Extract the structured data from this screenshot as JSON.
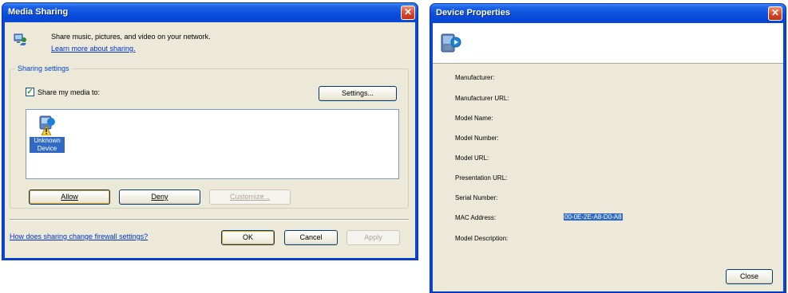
{
  "media_sharing": {
    "title": "Media Sharing",
    "intro_text": "Share music, pictures, and video on your network.",
    "learn_more_link": "Learn more about sharing.",
    "group_title": "Sharing settings",
    "share_checkbox_label": "Share my media to:",
    "share_checked": true,
    "settings_button": "Settings...",
    "device": {
      "name_line1": "Unknown",
      "name_line2": "Device"
    },
    "allow_button": "Allow",
    "deny_button": "Deny",
    "customize_button": "Customize...",
    "firewall_link": "How does sharing change firewall settings?",
    "ok_button": "OK",
    "cancel_button": "Cancel",
    "apply_button": "Apply"
  },
  "device_properties": {
    "title": "Device Properties",
    "labels": {
      "manufacturer": "Manufacturer:",
      "manufacturer_url": "Manufacturer URL:",
      "model_name": "Model Name:",
      "model_number": "Model Number:",
      "model_url": "Model URL:",
      "presentation_url": "Presentation URL:",
      "serial_number": "Serial Number:",
      "mac_address": "MAC Address:",
      "model_description": "Model Description:"
    },
    "mac_value": "00-0E-2E-A8-D0-A8",
    "close_button": "Close"
  },
  "colors": {
    "title_bar": "#0a50dc",
    "dialog_face": "#ece9d8",
    "close_button": "#d8412a",
    "selection": "#316ac5",
    "link": "#0033cc"
  }
}
